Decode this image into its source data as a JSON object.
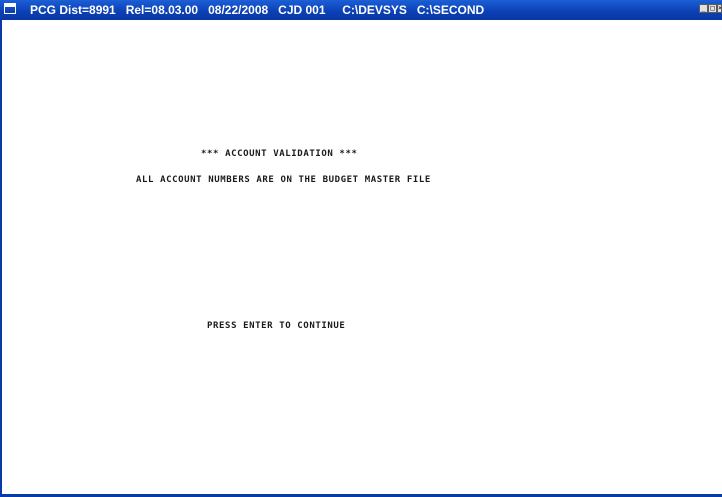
{
  "window": {
    "title": "PCG Dist=8991   Rel=08.03.00   08/22/2008   CJD 001     C:\\DEVSYS   C:\\SECOND",
    "controls": {
      "minimize_glyph": "_",
      "maximize_glyph": "□",
      "close_glyph": "×"
    }
  },
  "screen": {
    "title": "*** ACCOUNT VALIDATION ***",
    "message": "ALL ACCOUNT NUMBERS ARE ON THE BUDGET MASTER FILE",
    "prompt": "PRESS ENTER TO CONTINUE"
  },
  "colors": {
    "titlebar": "#0b3fb4",
    "background": "#ffffff",
    "text": "#1a1a1a"
  }
}
